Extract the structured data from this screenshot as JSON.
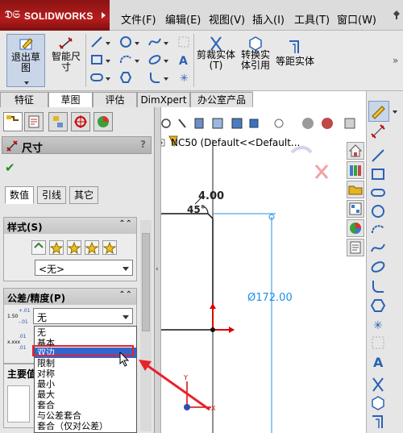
{
  "app": {
    "logo": "SOLIDWORKS",
    "menu": [
      "文件(F)",
      "编辑(E)",
      "视图(V)",
      "插入(I)",
      "工具(T)",
      "窗口(W)"
    ]
  },
  "commands": {
    "exit_sketch": "退出草图",
    "smart_dim": "智能尺寸",
    "trim": "剪裁实体(T)",
    "convert": "转换实体引用",
    "offset": "等距实体"
  },
  "tabs": [
    "特征",
    "草图",
    "评估",
    "DimXpert",
    "办公室产品"
  ],
  "active_tab": 1,
  "property_manager": {
    "title": "尺寸",
    "help": "?",
    "subtabs": [
      "数值",
      "引线",
      "其它"
    ],
    "style_group": {
      "title": "样式(S)",
      "select_value": "<无>"
    },
    "tolerance_group": {
      "title": "公差/精度(P)",
      "select_value": "无",
      "sample_top": "+.01",
      "sample_mid": "1.50",
      "sample_bot": "-.01",
      "sample2_top": ".01",
      "sample2_mid": "x.xxx",
      "sample2_bot": ".01"
    },
    "main_group_title": "主要值"
  },
  "tolerance_options": [
    "无",
    "基本",
    "双边",
    "限制",
    "对称",
    "最小",
    "最大",
    "套合",
    "与公差套合",
    "套合（仅对公差）"
  ],
  "selected_option": 2,
  "graphics": {
    "tree_label": "NC50  (Default<<Default...",
    "dim_400": "4.00",
    "dim_45": "45°",
    "dim_172": "Ø172.00"
  },
  "colors": {
    "accent_red": "#e8212b",
    "dim_blue": "#1e90e8",
    "selection_blue": "#3366cc",
    "title_red": "#b81d1d"
  }
}
